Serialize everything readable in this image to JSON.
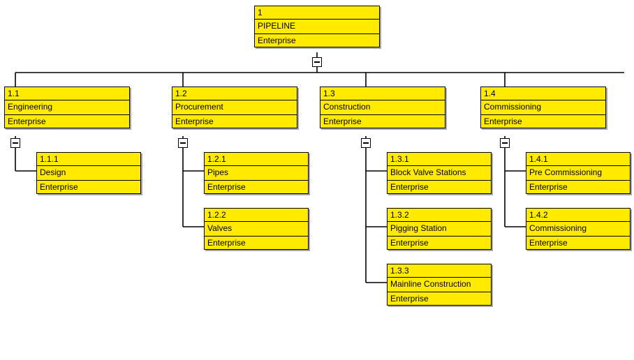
{
  "root": {
    "id": "1",
    "name": "PIPELINE",
    "level": "Enterprise"
  },
  "cols": [
    {
      "id": "1.1",
      "name": "Engineering",
      "level": "Enterprise",
      "children": [
        {
          "id": "1.1.1",
          "name": "Design",
          "level": "Enterprise"
        }
      ]
    },
    {
      "id": "1.2",
      "name": "Procurement",
      "level": "Enterprise",
      "children": [
        {
          "id": "1.2.1",
          "name": "Pipes",
          "level": "Enterprise"
        },
        {
          "id": "1.2.2",
          "name": "Valves",
          "level": "Enterprise"
        }
      ]
    },
    {
      "id": "1.3",
      "name": "Construction",
      "level": "Enterprise",
      "children": [
        {
          "id": "1.3.1",
          "name": "Block Valve Stations",
          "level": "Enterprise"
        },
        {
          "id": "1.3.2",
          "name": "Pigging Station",
          "level": "Enterprise"
        },
        {
          "id": "1.3.3",
          "name": "Mainline Construction",
          "level": "Enterprise"
        }
      ]
    },
    {
      "id": "1.4",
      "name": "Commissioning",
      "level": "Enterprise",
      "children": [
        {
          "id": "1.4.1",
          "name": "Pre Commissioning",
          "level": "Enterprise"
        },
        {
          "id": "1.4.2",
          "name": "Commissioning",
          "level": "Enterprise"
        }
      ]
    }
  ]
}
